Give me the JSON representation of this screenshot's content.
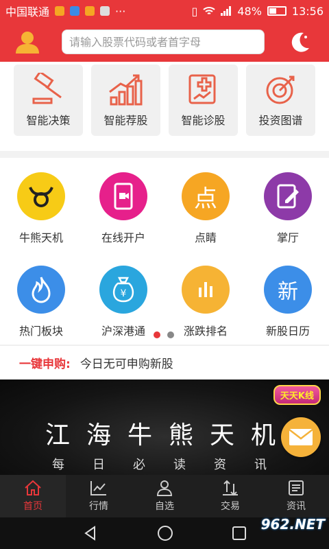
{
  "status": {
    "carrier": "中国联通",
    "battery": "48%",
    "time": "13:56",
    "battery_level": 0.48
  },
  "header": {
    "search_placeholder": "请输入股票代码或者首字母"
  },
  "tools": [
    {
      "label": "智能决策",
      "icon": "gavel-icon"
    },
    {
      "label": "智能荐股",
      "icon": "growth-chart-icon"
    },
    {
      "label": "智能诊股",
      "icon": "medical-chart-icon"
    },
    {
      "label": "投资图谱",
      "icon": "target-icon"
    }
  ],
  "grid": [
    {
      "label": "牛熊天机",
      "icon": "bull-icon",
      "color": "#f7cb16",
      "glyph": ""
    },
    {
      "label": "在线开户",
      "icon": "phone-video-icon",
      "color": "#e6208b",
      "glyph": ""
    },
    {
      "label": "点睛",
      "icon": "dian-icon",
      "color": "#f6a623",
      "glyph": "点"
    },
    {
      "label": "掌厅",
      "icon": "tablet-edit-icon",
      "color": "#8d3aa8",
      "glyph": ""
    },
    {
      "label": "热门板块",
      "icon": "flame-icon",
      "color": "#3c8ee8",
      "glyph": ""
    },
    {
      "label": "沪深港通",
      "icon": "money-bag-icon",
      "color": "#2aa6de",
      "glyph": ""
    },
    {
      "label": "涨跌排名",
      "icon": "bar-chart-icon",
      "color": "#f6b334",
      "glyph": ""
    },
    {
      "label": "新股日历",
      "icon": "new-icon",
      "color": "#3c8ee8",
      "glyph": "新"
    }
  ],
  "ipo": {
    "title": "一键申购:",
    "text": "今日无可申购新股"
  },
  "banner": {
    "title": "江海牛熊天机",
    "subtitle": "每日必读资讯",
    "badge": "天天K线"
  },
  "tabs": [
    {
      "label": "首页",
      "icon": "home-icon"
    },
    {
      "label": "行情",
      "icon": "market-icon"
    },
    {
      "label": "自选",
      "icon": "user-icon"
    },
    {
      "label": "交易",
      "icon": "trade-icon"
    },
    {
      "label": "资讯",
      "icon": "news-icon"
    }
  ],
  "watermark": "962.NET",
  "colors": {
    "brand": "#e8373a",
    "tabbar": "#1f1f1f"
  }
}
